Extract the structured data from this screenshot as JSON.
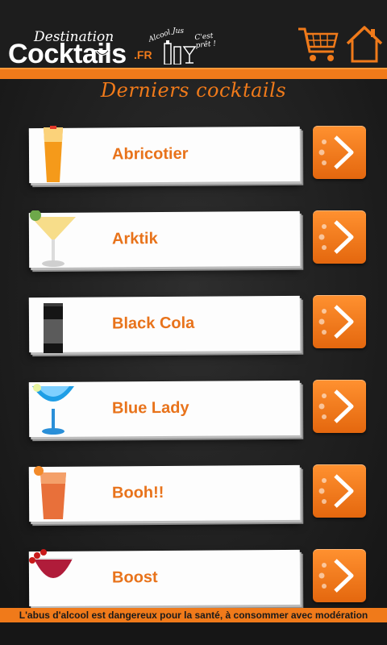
{
  "header": {
    "logo_top": "Destination",
    "logo_main": "Cocktails",
    "logo_fr": ".FR",
    "tags": [
      "Alcool",
      "Jus",
      "C'est prêt !"
    ]
  },
  "section_title": "Derniers cocktails",
  "cocktails": [
    {
      "label": "Abricotier",
      "icon": "tall-orange-glass"
    },
    {
      "label": "Arktik",
      "icon": "martini-glass"
    },
    {
      "label": "Black Cola",
      "icon": "dark-highball-glass"
    },
    {
      "label": "Blue Lady",
      "icon": "blue-coupe-glass"
    },
    {
      "label": "Booh!!",
      "icon": "orange-tumbler-glass"
    },
    {
      "label": "Boost",
      "icon": "red-cocktail-glass"
    }
  ],
  "footer_warning": "L'abus d'alcool est dangereux pour la santé, à consommer avec modération",
  "colors": {
    "accent": "#f07a1a",
    "background": "#232323",
    "card": "#fdfdfd"
  }
}
